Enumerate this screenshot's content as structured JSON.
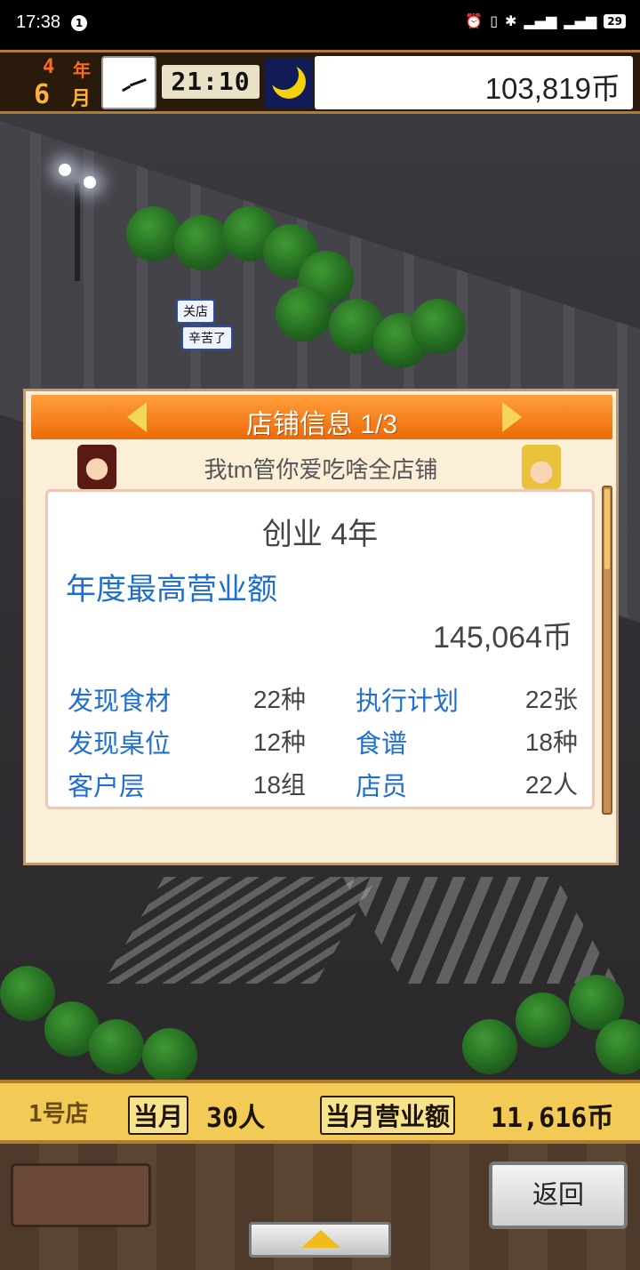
{
  "status_bar": {
    "time": "17:38",
    "notification_count": "1",
    "battery": "29"
  },
  "hud": {
    "year_num": "4",
    "year_unit": "年",
    "month_num": "6",
    "month_unit": "月",
    "clock_time": "21:10",
    "money": "103,819币"
  },
  "speech": {
    "bubble1": "关店",
    "bubble2": "辛苦了"
  },
  "panel": {
    "title": "店铺信息 1/3",
    "shop_name": "我tm管你爱吃啥全店铺",
    "founded": "创业 4年",
    "best_sales_label": "年度最高营业额",
    "best_sales_value": "145,064币",
    "stats": [
      {
        "label": "发现食材",
        "value": "22种"
      },
      {
        "label": "执行计划",
        "value": "22张"
      },
      {
        "label": "发现桌位",
        "value": "12种"
      },
      {
        "label": "食谱",
        "value": "18种"
      },
      {
        "label": "客户层",
        "value": "18组"
      },
      {
        "label": "店员",
        "value": "22人"
      }
    ]
  },
  "bottom_bar": {
    "shop": "1号店",
    "this_month": "当月",
    "customers": "30人",
    "monthly_sales_label": "当月营业额",
    "monthly_sales_value": "11,616币"
  },
  "buttons": {
    "back": "返回"
  },
  "colors": {
    "header_orange": "#ee6a06",
    "label_blue": "#1f6fd0",
    "bar_yellow": "#f2cb56"
  }
}
